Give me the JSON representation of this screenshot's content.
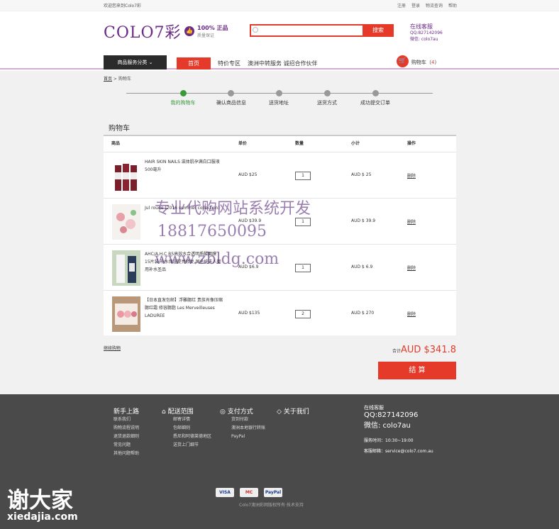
{
  "topbar": {
    "welcome": "欢迎您来到Colo7彩",
    "links": [
      "注册",
      "登录",
      "物流查询",
      "帮助"
    ]
  },
  "header": {
    "logo": "COLO7彩",
    "quality_title": "100% 正品",
    "quality_sub": "质量保证",
    "search_placeholder": "",
    "search_button": "搜索",
    "service_title": "在线客服",
    "service_qq": "QQ:827142096",
    "service_wechat": "微信: colo7au"
  },
  "nav": {
    "category": "商品服务分类",
    "category_icon": "chevron-down-icon",
    "home": "首页",
    "items": [
      "特价专区",
      "澳洲中转服务 诚招合作伙伴"
    ],
    "cart_label": "购物车（",
    "cart_count": "4",
    "cart_close": "）"
  },
  "breadcrumb": {
    "home": "首页",
    "sep": " > ",
    "current": "购物车"
  },
  "steps": [
    "我的购物车",
    "确认商品信息",
    "送货地址",
    "送货方式",
    "成功提交订单"
  ],
  "cart": {
    "title": "购物车",
    "headers": {
      "product": "商品",
      "price": "单价",
      "qty": "数量",
      "subtotal": "小计",
      "action": "操作"
    },
    "rows": [
      {
        "name": "HAIR SKIN NAILS 滋体肌孕满白口服液 500毫升",
        "price": "AUD $25",
        "qty": "1",
        "subtotal": "AUD $ 25",
        "action": "删除"
      },
      {
        "name": "Jul   rouge (2016 summer collection)",
        "price": "AUD $39.9",
        "qty": "1",
        "subtotal": "AUD $ 39.9",
        "action": "删除"
      },
      {
        "name": "AHC/A.H.C B5高效水合透明质酸面膜 15片装 补水保湿提亮修复 国总统夫人御用补水圣品",
        "price": "AUD $6.9",
        "qty": "1",
        "subtotal": "AUD $ 6.9",
        "action": "删除"
      },
      {
        "name": "【日本直发包邮】浮雕腮红 贵族肖像压缩腮红霜 修容腮脂 Les Merveilleuses LADUREE",
        "price": "AUD $135",
        "qty": "2",
        "subtotal": "AUD $ 270",
        "action": "删除"
      }
    ],
    "continue": "继续购物",
    "total_label": "合计",
    "total": "AUD $341.8",
    "checkout": "结 算"
  },
  "footer": {
    "columns": [
      {
        "title": "新手上路",
        "items": [
          "联系我们",
          "购物流程说明",
          "退货退款细则",
          "常见问题",
          "其他问题帮助"
        ]
      },
      {
        "title": "配送范围",
        "items": [
          "邮寄详情",
          "包邮细则",
          "悉尼和阿德莱德地区",
          "送货上门细节"
        ]
      },
      {
        "title": "支付方式",
        "items": [
          "货到付款",
          "澳洲本地银行转账",
          "PayPal"
        ]
      },
      {
        "title": "关于我们",
        "items": []
      }
    ],
    "service_title": "在线客服",
    "qq": "QQ:827142096",
    "wechat": "微信: colo7au",
    "hours": "服务时间：10:30~19:00",
    "email": "客服邮箱：service@colo7.com.au",
    "cards": [
      "VISA",
      "MC",
      "PayPal"
    ],
    "copyright": "Colo7澳洲彩网版权所有·技术支持"
  },
  "watermark": {
    "line1": "专业代购网站系统开发",
    "phone": "18817650095",
    "url": "www.zbldg.com",
    "brand": "谢大家",
    "brand_url": "xiedajia.com"
  }
}
